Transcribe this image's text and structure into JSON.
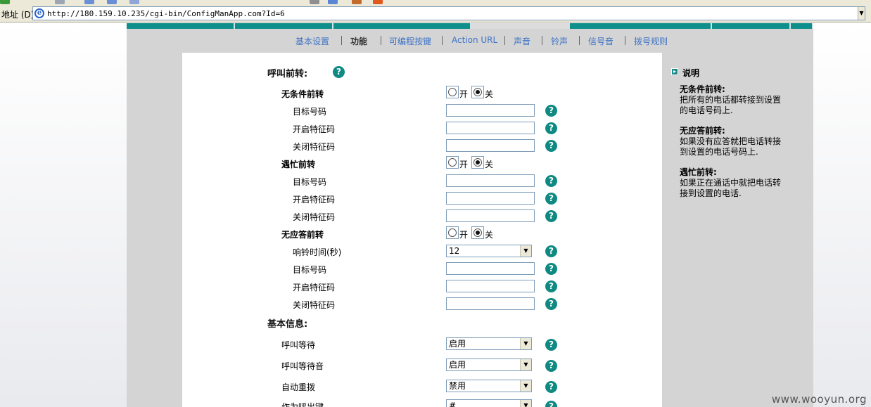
{
  "browser": {
    "address_label": "地址 (D)",
    "url": "http://180.159.10.235/cgi-bin/ConfigManApp.com?Id=6"
  },
  "nav": {
    "items": [
      "基本设置",
      "功能",
      "可编程按键",
      "Action URL",
      "声音",
      "铃声",
      "信号音",
      "拨号规则"
    ],
    "active": "功能"
  },
  "forwarding": {
    "title": "呼叫前转:",
    "radio_on": "开",
    "radio_off": "关",
    "groups": [
      {
        "label": "无条件前转",
        "selected": "关",
        "fields": [
          {
            "label": "目标号码",
            "value": ""
          },
          {
            "label": "开启特征码",
            "value": ""
          },
          {
            "label": "关闭特征码",
            "value": ""
          }
        ]
      },
      {
        "label": "遇忙前转",
        "selected": "关",
        "fields": [
          {
            "label": "目标号码",
            "value": ""
          },
          {
            "label": "开启特征码",
            "value": ""
          },
          {
            "label": "关闭特征码",
            "value": ""
          }
        ]
      },
      {
        "label": "无应答前转",
        "selected": "关",
        "ring_time": {
          "label": "响铃时间(秒)",
          "value": "12"
        },
        "fields": [
          {
            "label": "目标号码",
            "value": ""
          },
          {
            "label": "开启特征码",
            "value": ""
          },
          {
            "label": "关闭特征码",
            "value": ""
          }
        ]
      }
    ]
  },
  "basic": {
    "title": "基本信息:",
    "rows": [
      {
        "label": "呼叫等待",
        "value": "启用"
      },
      {
        "label": "呼叫等待音",
        "value": "启用"
      },
      {
        "label": "自动重拨",
        "value": "禁用"
      },
      {
        "label": "作为呼出键",
        "value": "#"
      }
    ]
  },
  "help_icon": "?",
  "sidebar": {
    "title": "说明",
    "blocks": [
      {
        "title": "无条件前转:",
        "text": "把所有的电话都转接到设置的电话号码上."
      },
      {
        "title": "无应答前转:",
        "text": "如果没有应答就把电话转接到设置的电话号码上."
      },
      {
        "title": "遇忙前转:",
        "text": "如果正在通话中就把电话转接到设置的电话."
      }
    ]
  },
  "watermark": "www.wooyun.org",
  "colors": {
    "accent": "#0e8f8c",
    "nav_link": "#3d72c5",
    "panel": "#d4d4d4"
  }
}
